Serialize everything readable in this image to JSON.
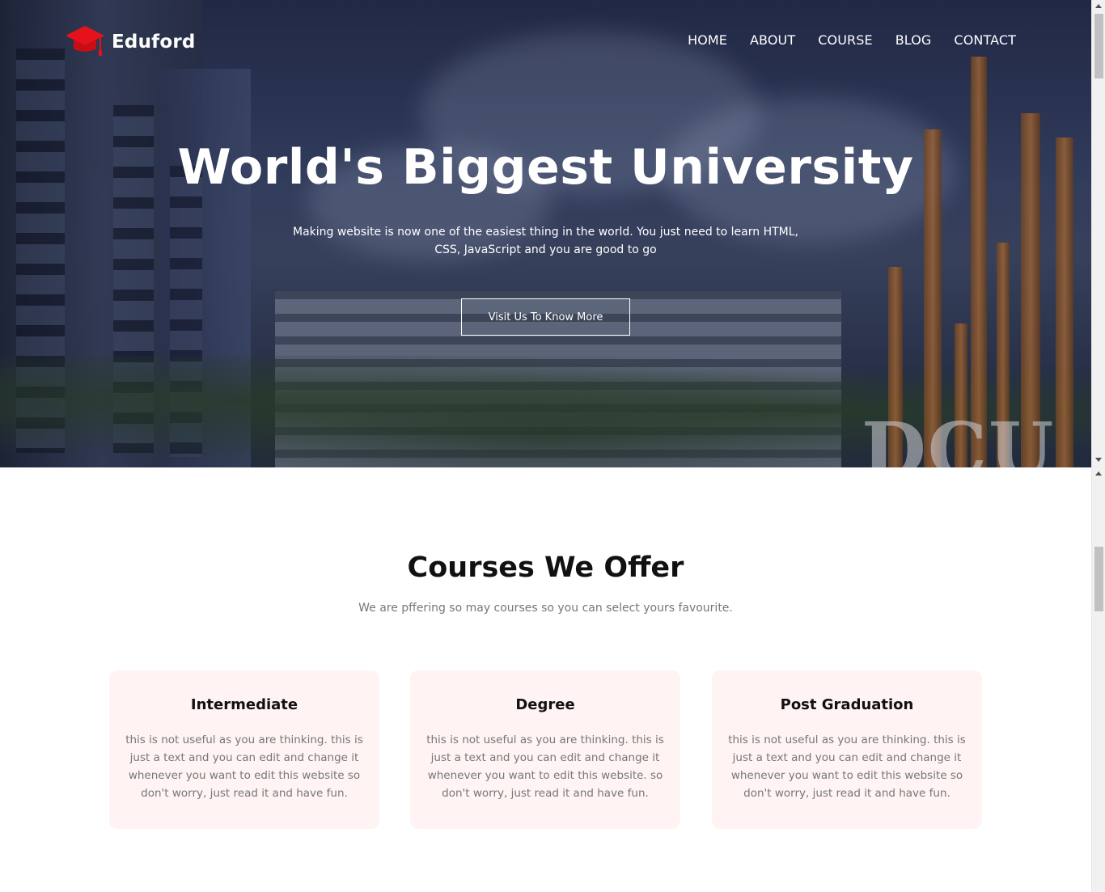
{
  "brand": {
    "name": "Eduford",
    "accent_color": "#e6121b",
    "logo_icon": "graduation-cap-icon"
  },
  "nav": {
    "items": [
      {
        "label": "HOME"
      },
      {
        "label": "ABOUT"
      },
      {
        "label": "COURSE"
      },
      {
        "label": "BLOG"
      },
      {
        "label": "CONTACT"
      }
    ]
  },
  "hero": {
    "title": "World's Biggest University",
    "subtitle": "Making website is now one of the easiest thing in the world. You just need to learn HTML, CSS, JavaScript and you are good to go",
    "button_label": "Visit Us To Know More",
    "background_sign": "DCU"
  },
  "courses": {
    "title": "Courses We Offer",
    "subtitle": "We are pffering so may courses so you can select yours favourite.",
    "card_bg_color": "#fff3f3",
    "items": [
      {
        "title": "Intermediate",
        "text": "this is not useful as you are thinking. this is just a text and you can edit and change it whenever you want to edit this website so don't worry, just read it and have fun."
      },
      {
        "title": "Degree",
        "text": "this is not useful as you are thinking. this is just a text and you can edit and change it whenever you want to edit this website. so don't worry, just read it and have fun."
      },
      {
        "title": "Post Graduation",
        "text": "this is not useful as you are thinking. this is just a text and you can edit and change it whenever you want to edit this website so don't worry, just read it and have fun."
      }
    ]
  }
}
